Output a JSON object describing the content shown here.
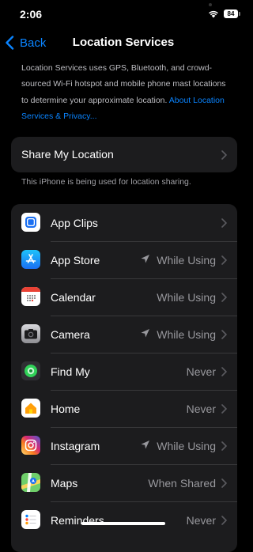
{
  "status_bar": {
    "time": "2:06",
    "battery": "84"
  },
  "nav": {
    "back_label": "Back",
    "title": "Location Services"
  },
  "description": {
    "text": "Location Services uses GPS, Bluetooth, and crowd-sourced Wi-Fi hotspot and mobile phone mast locations to determine your approximate location. ",
    "link": "About Location Services & Privacy..."
  },
  "share": {
    "label": "Share My Location",
    "footer": "This iPhone is being used for location sharing."
  },
  "apps": [
    {
      "name": "App Clips",
      "status": "",
      "arrow": false
    },
    {
      "name": "App Store",
      "status": "While Using",
      "arrow": true
    },
    {
      "name": "Calendar",
      "status": "While Using",
      "arrow": false
    },
    {
      "name": "Camera",
      "status": "While Using",
      "arrow": true
    },
    {
      "name": "Find My",
      "status": "Never",
      "arrow": false
    },
    {
      "name": "Home",
      "status": "Never",
      "arrow": false
    },
    {
      "name": "Instagram",
      "status": "While Using",
      "arrow": true
    },
    {
      "name": "Maps",
      "status": "When Shared",
      "arrow": false
    },
    {
      "name": "Reminders",
      "status": "Never",
      "arrow": false
    }
  ],
  "icons": {
    "apps": [
      "app-clips-icon",
      "app-store-icon",
      "calendar-icon",
      "camera-icon",
      "find-my-icon",
      "home-icon",
      "instagram-icon",
      "maps-icon",
      "reminders-icon"
    ],
    "location_arrow": "location-arrow-icon",
    "chevron": "chevron-right-icon",
    "back": "chevron-left-icon"
  },
  "colors": {
    "accent": "#0a84ff",
    "background": "#000000",
    "card": "#1c1c1e",
    "secondary_text": "#98989d"
  }
}
